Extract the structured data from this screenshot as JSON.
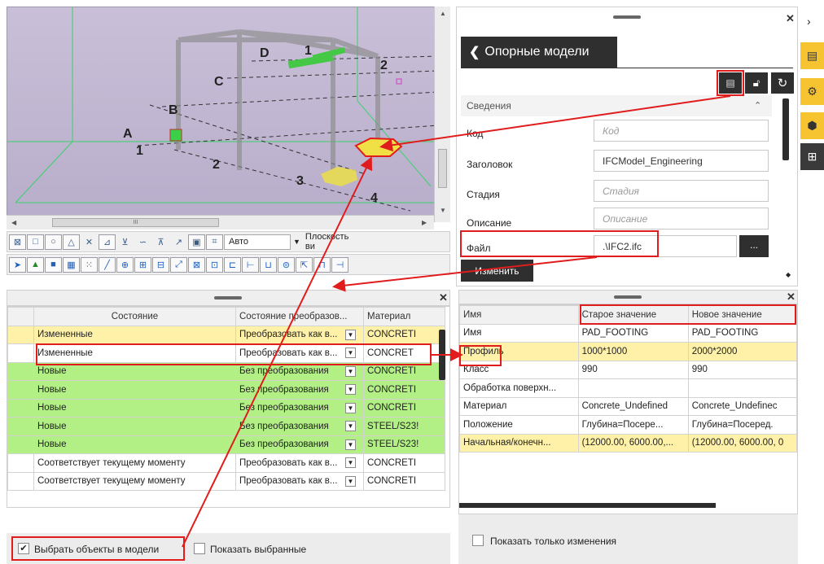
{
  "viewport": {
    "labels": {
      "A": "A",
      "B": "B",
      "C": "C",
      "D": "D",
      "n1": "1",
      "n2": "2",
      "n3": "3",
      "n4": "4",
      "g1": "1",
      "g2": "2"
    },
    "hscroll_mark": "III",
    "toolbar_combo_auto": "Авто",
    "toolbar_combo_plane": "Плоскость ви"
  },
  "ref": {
    "back_title": "Опорные модели",
    "section": "Сведения",
    "fields": [
      {
        "label": "Код",
        "value": "",
        "placeholder": "Код"
      },
      {
        "label": "Заголовок",
        "value": "IFCModel_Engineering",
        "placeholder": ""
      },
      {
        "label": "Стадия",
        "value": "",
        "placeholder": "Стадия"
      },
      {
        "label": "Описание",
        "value": "",
        "placeholder": "Описание"
      },
      {
        "label": "Файл",
        "value": ".\\IFC2.ifc",
        "placeholder": ""
      }
    ],
    "browse": "...",
    "change_button": "Изменить"
  },
  "left_table": {
    "headers": [
      "Состояние",
      "Состояние преобразов...",
      "Материал"
    ],
    "rows": [
      {
        "state": "Измененные",
        "conv": "Преобразовать как в...",
        "mat": "CONCRETI",
        "style": "yellow"
      },
      {
        "state": "Измененные",
        "conv": "Преобразовать как в...",
        "mat": "CONCRET",
        "style": "white"
      },
      {
        "state": "Новые",
        "conv": "Без преобразования",
        "mat": "CONCRETI",
        "style": "green"
      },
      {
        "state": "Новые",
        "conv": "Без преобразования",
        "mat": "CONCRETI",
        "style": "green"
      },
      {
        "state": "Новые",
        "conv": "Без преобразования",
        "mat": "CONCRETI",
        "style": "green"
      },
      {
        "state": "Новые",
        "conv": "Без преобразования",
        "mat": "STEEL/S23!",
        "style": "green"
      },
      {
        "state": "Новые",
        "conv": "Без преобразования",
        "mat": "STEEL/S23!",
        "style": "green"
      },
      {
        "state": "Соответствует текущему моменту",
        "conv": "Преобразовать как в...",
        "mat": "CONCRETI",
        "style": "white"
      },
      {
        "state": "Соответствует текущему моменту",
        "conv": "Преобразовать как в...",
        "mat": "CONCRETI",
        "style": "white"
      }
    ],
    "select_in_model": "Выбрать объекты в модели",
    "show_selected": "Показать выбранные"
  },
  "right_table": {
    "headers": [
      "Имя",
      "Старое значение",
      "Новое значение"
    ],
    "rows": [
      {
        "name": "Имя",
        "old": "PAD_FOOTING",
        "new": "PAD_FOOTING",
        "style": "white"
      },
      {
        "name": "Профиль",
        "old": "1000*1000",
        "new": "2000*2000",
        "style": "yellow"
      },
      {
        "name": "Класс",
        "old": "990",
        "new": "990",
        "style": "white"
      },
      {
        "name": "Обработка поверхн...",
        "old": "",
        "new": "",
        "style": "white"
      },
      {
        "name": "Материал",
        "old": "Concrete_Undefined",
        "new": "Concrete_Undefinec",
        "style": "white"
      },
      {
        "name": "Положение",
        "old": "Глубина=Посере...",
        "new": "Глубина=Посеред.",
        "style": "white"
      },
      {
        "name": "Начальная/конечн...",
        "old": "(12000.00, 6000.00,...",
        "new": "(12000.00, 6000.00, 0",
        "style": "yellow"
      }
    ],
    "show_only_changes": "Показать только изменения"
  },
  "colors": {
    "accent_dark": "#2f2f2f",
    "yellow_row": "#fff2a8",
    "green_row": "#b2ef85",
    "highlight": "#e01c1c",
    "side_tab": "#f7c431"
  }
}
